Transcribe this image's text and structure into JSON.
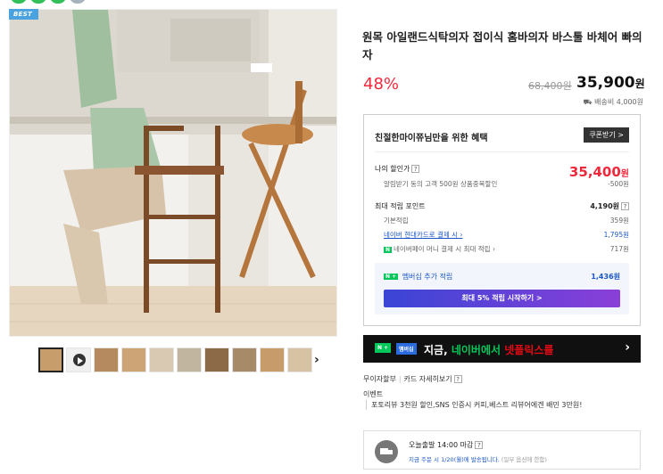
{
  "gallery": {
    "badge": "BEST",
    "thumb_count": 10,
    "next_label": "›"
  },
  "product": {
    "title": "원목 아일랜드식탁의자 접이식 홈바의자 바스툴 바체어 빠의자",
    "discount_rate": "48%",
    "original_price": "68,400원",
    "sale_price_num": "35,900",
    "sale_price_unit": "원",
    "shipping": "배송비 4,000원"
  },
  "benefits": {
    "heading": "친절한마이쮸님만을 위한 혜택",
    "coupon_button": "쿠폰받기 >",
    "my_price_label": "나의 할인가",
    "my_price_num": "35,400",
    "my_price_unit": "원",
    "alarm_label": "알림받기 동의 고객 500원 상품중복할인",
    "alarm_value": "-500원",
    "max_points_label": "최대 적립 포인트",
    "max_points_value": "4,190원",
    "basic_label": "기본적립",
    "basic_value": "359원",
    "card_label": "네이버 현대카드로 결제 시",
    "card_value": "1,795원",
    "npay_label": "네이버페이 머니 결제 시 최대 적립",
    "npay_value": "717원",
    "member_label": "멤버십 추가 적립",
    "member_value": "1,436원",
    "member_button": "최대 5% 적립 시작하기 >"
  },
  "promo": {
    "tag1": "N +",
    "tag2": "멤버십",
    "text_a": "지금,",
    "text_b": "네이버에서",
    "text_c": "넷플릭스를",
    "chevron": "›"
  },
  "info": {
    "installment": "무이자할부",
    "card_detail": "카드 자세히보기",
    "event_label": "이벤트",
    "event_text": "포토리뷰 3천원 할인,SNS 인증시 커피,베스트 리뷰어에겐 배민 3만원!"
  },
  "delivery": {
    "title": "오늘출발 14:00 마감",
    "sub": "지금 주문 시 1/20(월)에 발송됩니다.",
    "sub_note": "(일부 옵션에 한함)"
  },
  "colors": {
    "accent_red": "#f0283c",
    "naver_green": "#03c75a",
    "link_blue": "#1a56c7"
  }
}
